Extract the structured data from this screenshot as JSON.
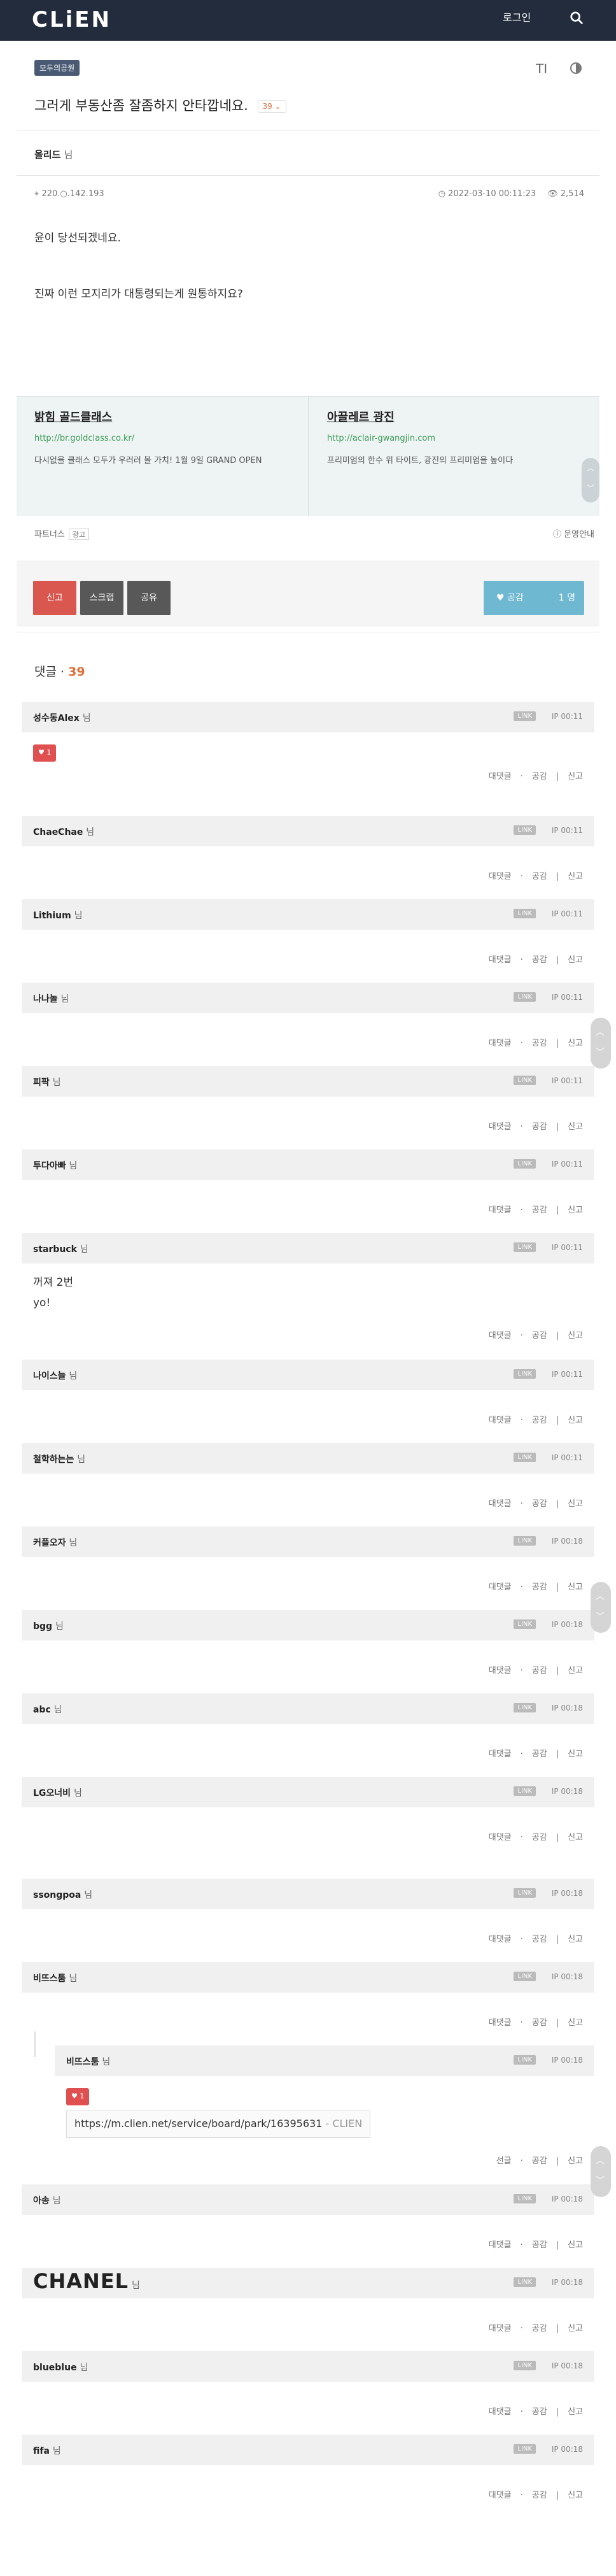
{
  "header": {
    "logo": "CLiEN",
    "login": "로그인"
  },
  "board": {
    "tag": "모두의공원",
    "title": "그러게 부동산좀 잘좀하지 안타깝네요.",
    "reply_badge": "39 ⌄"
  },
  "post": {
    "author": "올리드",
    "nim": "님",
    "ip": "220.○.142.193",
    "datetime": "2022-03-10 00:11:23",
    "views": "2,514",
    "paragraphs": [
      "윤이 당선되겠네요.",
      "진짜 이런 모지리가 대통령되는게 원통하지요?"
    ]
  },
  "ads": [
    {
      "title": "밝힘 골드클래스",
      "url": "http://br.goldclass.co.kr/",
      "desc": "다시없을 클래스 모두가 우러러 볼 가치! 1월 9일 GRAND OPEN"
    },
    {
      "title": "아끌레르 광진",
      "url": "http://aclair-gwangjin.com",
      "desc": "프리미엄의 한수 위 타이트, 광진의 프리미엄을 높이다"
    }
  ],
  "partner": {
    "label": "파트너스",
    "btn": "광고",
    "policy": "운영안내"
  },
  "actions": {
    "report": "신고",
    "scrap": "스크랩",
    "share": "공유",
    "like": "공감",
    "like_count": "1 명"
  },
  "comments_head": {
    "label": "댓글 · ",
    "count": "39"
  },
  "comment_common": {
    "nim": "님",
    "link": "LINK",
    "reply": "대댓글",
    "like": "공감",
    "report": "신고"
  },
  "comments": [
    {
      "name": "성수동Alex",
      "ip": "IP 00:11",
      "like": "♥ 1",
      "body": ""
    },
    {
      "name": "ChaeChae",
      "ip": "IP 00:11",
      "body": ""
    },
    {
      "name": "Lithium",
      "ip": "IP 00:11",
      "body": ""
    },
    {
      "name": "나나놀",
      "ip": "IP 00:11",
      "body": ""
    },
    {
      "name": "피팍",
      "ip": "IP 00:11",
      "body": ""
    },
    {
      "name": "투다아빠",
      "ip": "IP 00:11",
      "body": ""
    },
    {
      "name": "starbuck",
      "ip": "IP 00:11",
      "body": "꺼져 2번\nyo!"
    },
    {
      "name": "나이스늘",
      "ip": "IP 00:11",
      "body": ""
    },
    {
      "name": "철학하는는",
      "ip": "IP 00:11",
      "body": ""
    },
    {
      "name": "커플오자",
      "ip": "IP 00:18",
      "body": ""
    },
    {
      "name": "bgg",
      "ip": "IP 00:18",
      "body": ""
    },
    {
      "name": "abc",
      "ip": "IP 00:18",
      "body": ""
    },
    {
      "name": "LG오너비",
      "ip": "IP 00:18",
      "body": ""
    },
    {
      "name": "ssongpoa",
      "ip": "IP 00:18",
      "body": ""
    },
    {
      "name": "비뜨스툼",
      "ip": "IP 00:18",
      "body": ""
    },
    {
      "name": "비뜨스툼",
      "ip": "IP 00:18",
      "like": "♥ 1",
      "link_url": "https://m.clien.net/service/board/park/16395631",
      "link_src": "- CLIEN",
      "reply_label": "선글"
    },
    {
      "name": "아송",
      "ip": "IP 00:18",
      "body": ""
    },
    {
      "name": "CHANEL",
      "ip": "IP 00:18",
      "body": ""
    },
    {
      "name": "blueblue",
      "ip": "IP 00:18",
      "body": ""
    },
    {
      "name": "fifa",
      "ip": "IP 00:18",
      "body": ""
    }
  ]
}
